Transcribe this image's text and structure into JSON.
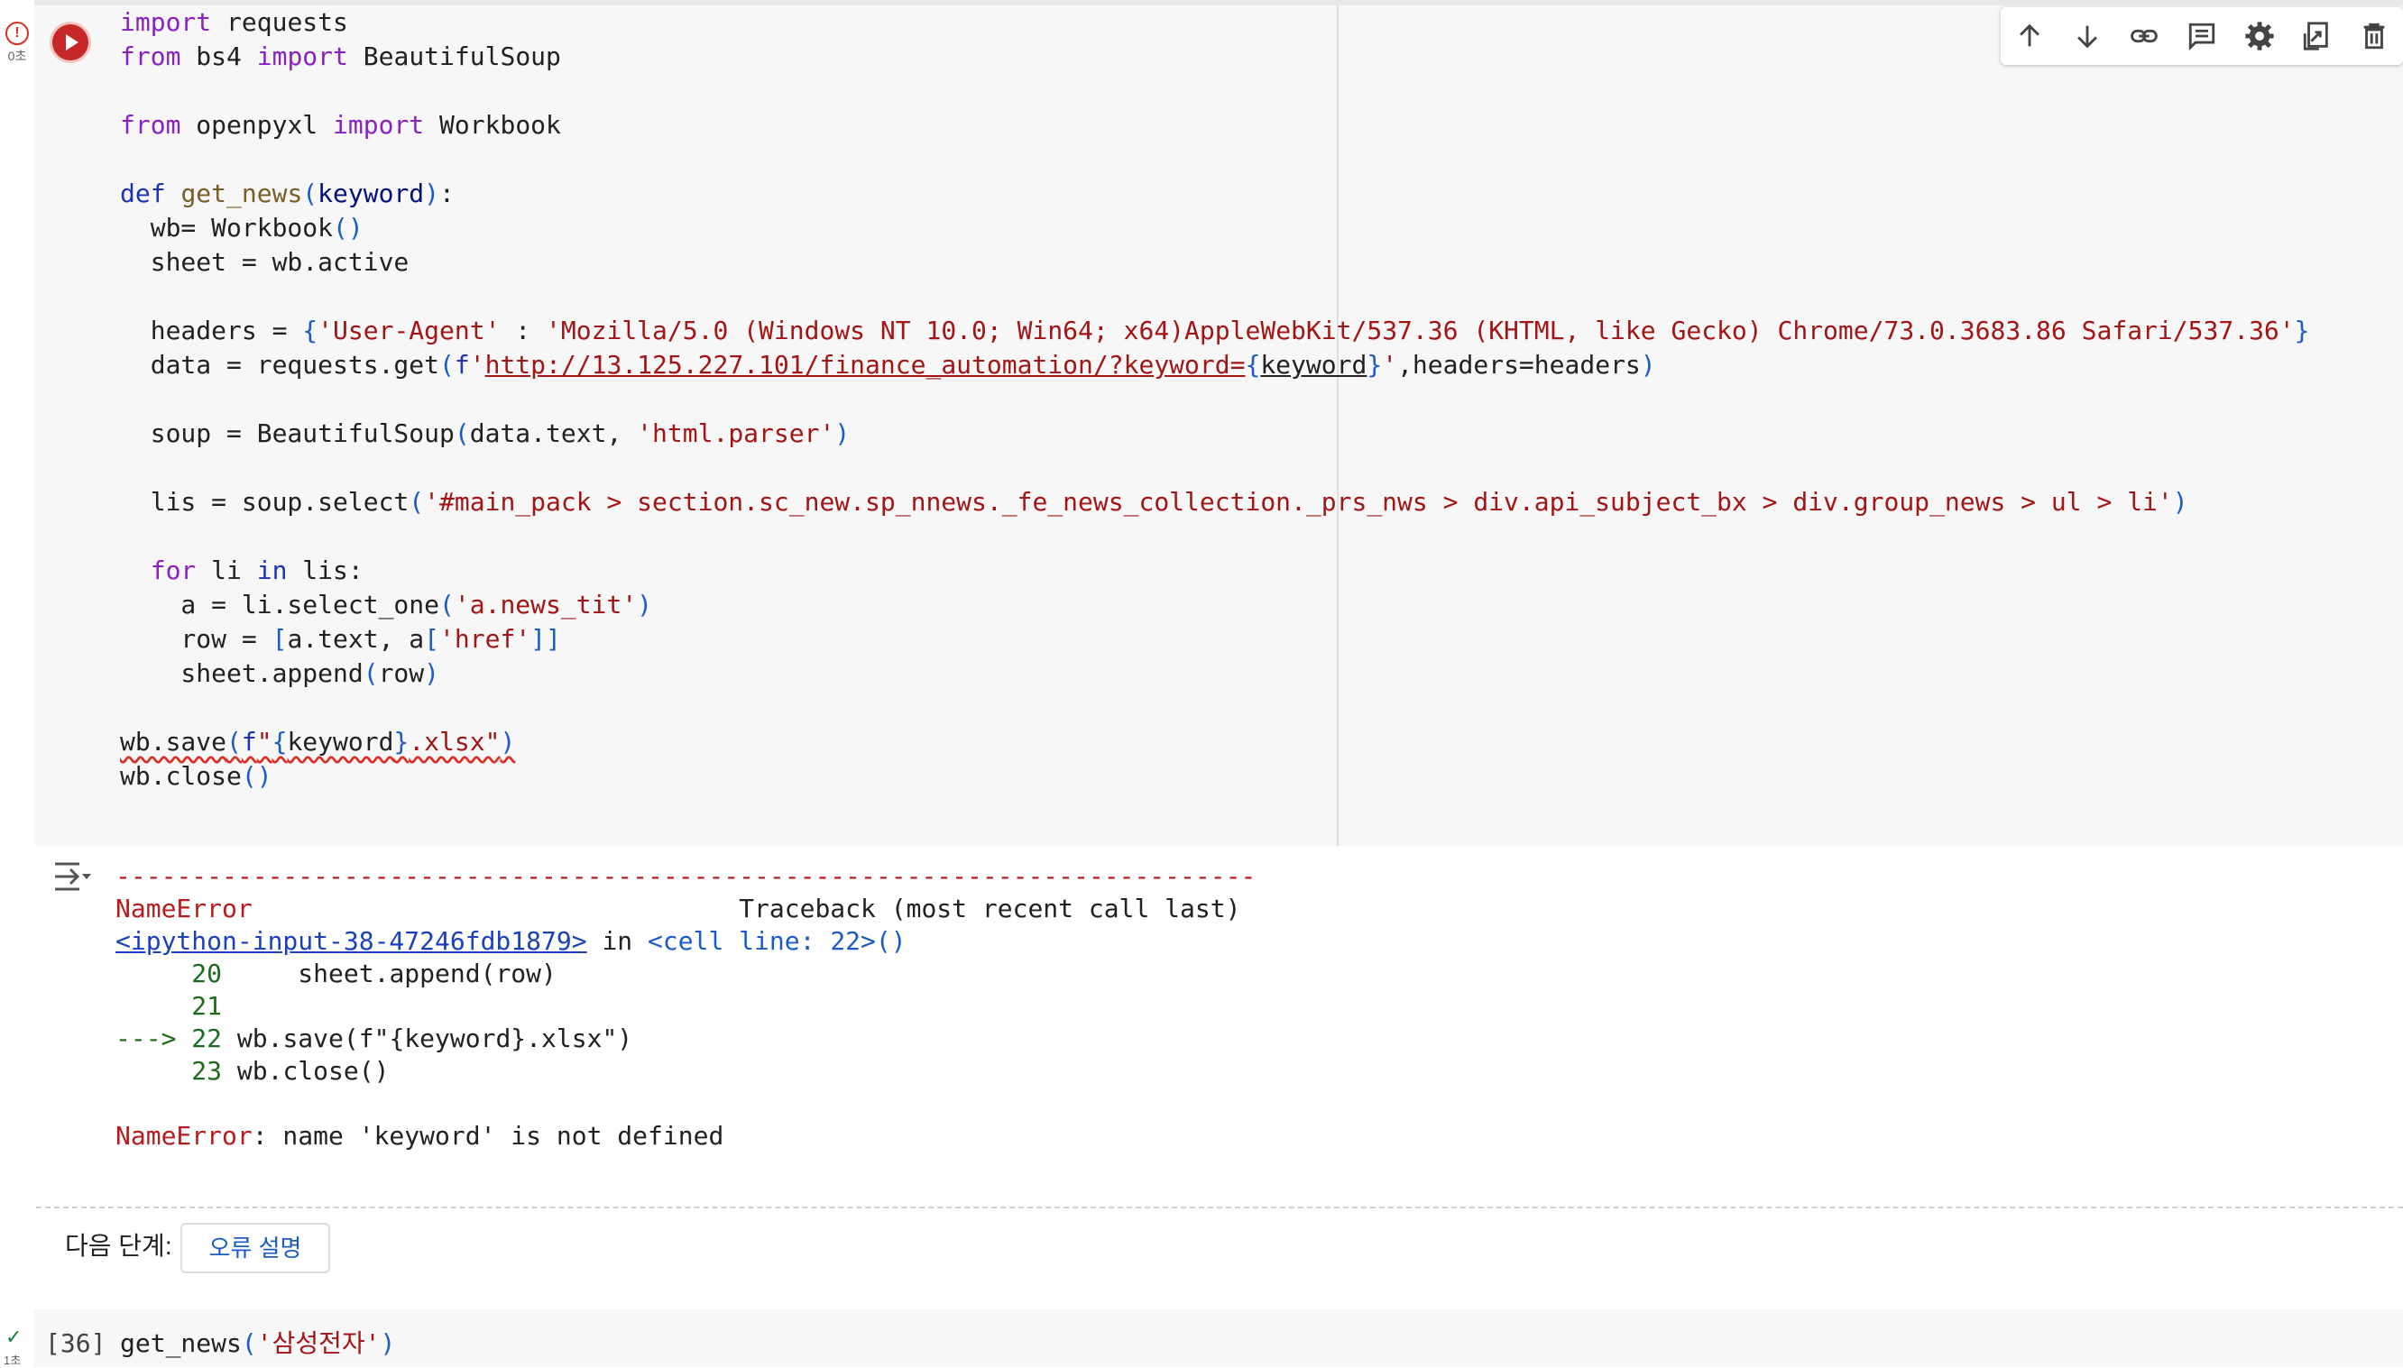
{
  "cell": {
    "exec_time": "0초",
    "run_state": "error",
    "code_lines": [
      "import requests",
      "from bs4 import BeautifulSoup",
      "",
      "from openpyxl import Workbook",
      "",
      "def get_news(keyword):",
      "  wb= Workbook()",
      "  sheet = wb.active",
      "",
      "  headers = {'User-Agent' : 'Mozilla/5.0 (Windows NT 10.0; Win64; x64)AppleWebKit/537.36 (KHTML, like Gecko) Chrome/73.0.3683.86 Safari/537.36'}",
      "  data = requests.get(f'http://13.125.227.101/finance_automation/?keyword={keyword}',headers=headers)",
      "",
      "  soup = BeautifulSoup(data.text, 'html.parser')",
      "",
      "  lis = soup.select('#main_pack > section.sc_new.sp_nnews._fe_news_collection._prs_nws > div.api_subject_bx > div.group_news > ul > li')",
      "",
      "  for li in lis:",
      "    a = li.select_one('a.news_tit')",
      "    row = [a.text, a['href']]",
      "    sheet.append(row)",
      "",
      "wb.save(f\"{keyword}.xlsx\")",
      "wb.close()"
    ]
  },
  "toolbar": {
    "icons": [
      "arrow-up-icon",
      "arrow-down-icon",
      "link-icon",
      "comment-icon",
      "settings-icon",
      "mirror-cell-icon",
      "delete-icon"
    ]
  },
  "output": {
    "dashes": "---------------------------------------------------------------------------",
    "error_name": "NameError",
    "traceback_title": "Traceback (most recent call last)",
    "input_ref": "<ipython-input-38-47246fdb1879>",
    "in_word": " in ",
    "cell_ref": "<cell line: 22>()",
    "lines": [
      {
        "arrow": "     ",
        "num": "20",
        "code": "     sheet.append(row)"
      },
      {
        "arrow": "     ",
        "num": "21",
        "code": ""
      },
      {
        "arrow": "---> ",
        "num": "22",
        "code": " wb.save(f\"{keyword}.xlsx\")"
      },
      {
        "arrow": "     ",
        "num": "23",
        "code": " wb.close()"
      }
    ],
    "error_label": "NameError",
    "error_message": ": name 'keyword' is not defined"
  },
  "next_steps": {
    "label": "다음 단계:",
    "button_label": "오류 설명"
  },
  "next_cell": {
    "exec_count": "[36]",
    "exec_time": "1초",
    "fn": "get_news",
    "arg": "'삼성전자'"
  },
  "colors": {
    "run_error": "#c62828",
    "keyword": "#8b1fc6",
    "string": "#a31515",
    "link": "#1a5cc7"
  }
}
